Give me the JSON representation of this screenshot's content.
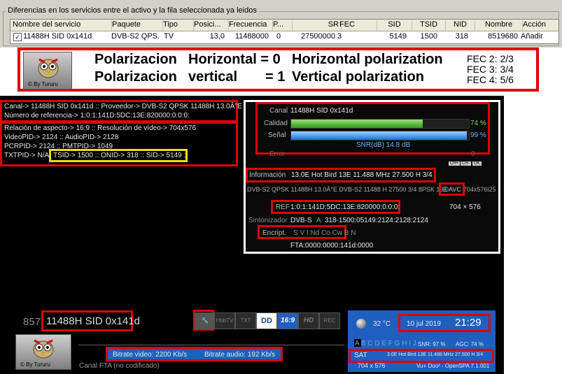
{
  "top_panel": {
    "group_title": "Diferencias en los servicios entre el activo y la fila seleccionada ya leidos",
    "columns": [
      "Nombre del servicio",
      "Paquete",
      "Tipo",
      "Posici...",
      "Frecuencia",
      "P...",
      "SR",
      "FEC",
      "SID",
      "TSID",
      "NID",
      "Nombre",
      "Acción"
    ],
    "row": [
      "11488H SID 0x141d",
      "DVB-S2 QPS...",
      "TV",
      "13,0",
      "11488000",
      "0",
      "27500000",
      "3",
      "5149",
      "1500",
      "318",
      "8519680",
      "Añadir"
    ]
  },
  "banner": {
    "logo_text": "© By Tururu",
    "line1": [
      "Polarizacion",
      "Horizontal = 0",
      "Horizontal polarization"
    ],
    "line2": [
      "Polarizacion",
      "vertical",
      "= 1",
      "Vertical polarization"
    ],
    "fec": [
      "FEC 2: 2/3",
      "FEC 3: 3/4",
      "FEC 4: 5/6"
    ]
  },
  "left_info": {
    "line1": "Canal-> 11488H SID 0x141d :: Proveedor-> DVB-S2 QPSK 11488H 13.0Â°E",
    "line2": "Número de referencia-> 1:0:1:141D:5DC:13E:820000:0:0:0:",
    "line3": "Relación de aspecto-> 16:9 :: Resolución de vídeo-> 704x576",
    "line4": "VideoPID-> 2124 :: AudioPID-> 2128",
    "line5": "PCRPID-> 2124 :: PMTPID-> 1049",
    "line6_prefix": "TXTPID-> N/A",
    "line6_boxed": "TSID-> 1500 :: ONID-> 318 :: SID-> 5149 ::"
  },
  "info_panel": {
    "canal_label": "Canal",
    "canal_value": "11488H SID 0x141d",
    "calidad_label": "Calidad",
    "calidad_pct": "74 %",
    "calidad_level": 0.74,
    "senal_label": "Señal",
    "senal_pct": "99 %",
    "senal_level": 0.99,
    "snr": "SNR(dB) 14.8 dB",
    "error_label": "Error",
    "error_value": "0",
    "buttons": [
      "CH+",
      "CH-",
      "OK"
    ],
    "informacion_label": "Información",
    "informacion_value": "13.0E Hot Bird 13E 11.488 MHz 27.500 H 3/4",
    "dvb_line": "DVB-S2 QPSK 11488H 13.0Â°E DVB-S2 11488 H 27500 3/4 8PSK 13.0",
    "avc_box": "E AVC",
    "res_suffix": "704x576i25",
    "res": "704 × 576",
    "ref_label": "REF",
    "ref_value": "1:0:1:141D:5DC:13E:820000:0:0:0:",
    "sint_label": "Sintonizador",
    "sint_value": "DVB-S",
    "sint_a": "A",
    "sint_pids": "318-1500:05149:2124:2128:2124",
    "encript_label": "Encript.",
    "encript_value": "S V I Nd Co Cw B N",
    "fta": "FTA:0000:0000:141d:0000"
  },
  "bottom": {
    "channel_num": "857",
    "channel_name": "11488H SID 0x141d",
    "icons": [
      "HbbTV",
      "TXT",
      "16:9",
      "HD",
      "REC"
    ],
    "bitrate_video": "Bitrate video:  2200 Kb/s",
    "bitrate_audio": "Bitrate audio:  192 Kb/s",
    "status": "Canal FTA (no codificado)",
    "logo_text": "© By Tururu"
  },
  "bottom_bar": {
    "temp": "32 °C",
    "date": "10 jul 2019",
    "time": "21:29",
    "letters": "A B C D E F G H I J",
    "snr": "SNR:  97 %",
    "agc": "AGC:  74 %",
    "sat_label": "SAT",
    "sat_info": "3.0E Hot Bird 13E 11.488 MHz 27.500 H 3/4",
    "res": "704 x 576",
    "box": "Vu+ Duo² - OpenSPA 7.1.001"
  }
}
